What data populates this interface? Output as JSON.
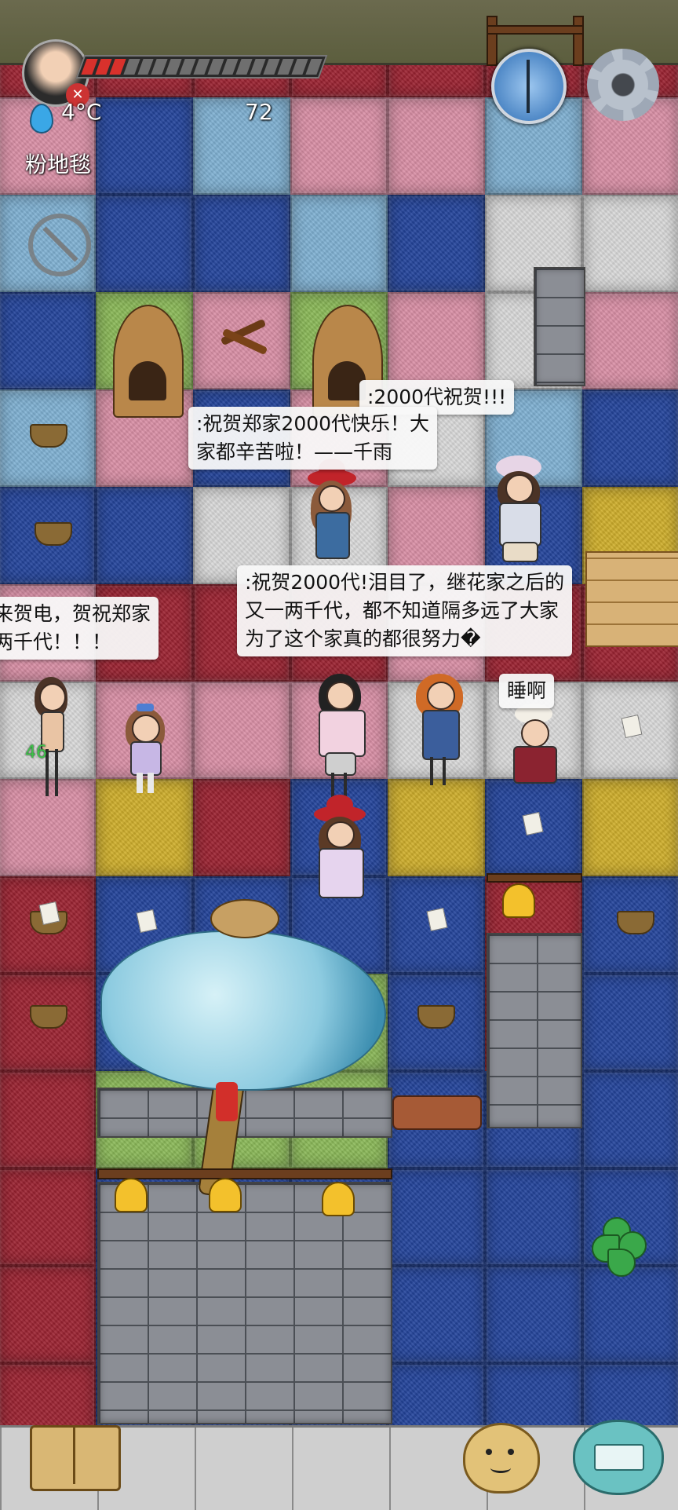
{
  "hud": {
    "temperature": "4°C",
    "food_count": "72",
    "location_label": "粉地毯",
    "health_segments_total": 17,
    "health_segments_filled": 3
  },
  "speech_bubbles": [
    {
      "id": "b1",
      "text": ":2000代祝贺!!!"
    },
    {
      "id": "b2",
      "text": ":祝贺郑家2000代快乐！大\n家都辛苦啦！——千雨"
    },
    {
      "id": "b3",
      "text": ":祝贺2000代!泪目了，继花家之后的\n又一两千代，都不知道隔多远了大家\n为了这个家真的都很努力�"
    },
    {
      "id": "b4",
      "text": "来贺电，贺祝郑家\n两千代！！！"
    },
    {
      "id": "b5",
      "text": "睡啊"
    }
  ],
  "player_age_label": "46",
  "icons": {
    "compass": "compass-icon",
    "settings": "gear-icon",
    "temperature": "thermometer-drop-icon",
    "mute": "no-sound-icon",
    "book": "book-icon",
    "emote": "potato-face-icon",
    "keyboard": "keyboard-chat-icon",
    "clover": "four-leaf-clover-icon"
  },
  "colors": {
    "red": "#9b2331",
    "pink": "#d98fa5",
    "blue": "#24459b",
    "light_blue": "#7fb1d3",
    "white": "#d9d9d9",
    "yellow": "#cfae2b",
    "green": "#8bb858",
    "health_red": "#d8312c"
  }
}
